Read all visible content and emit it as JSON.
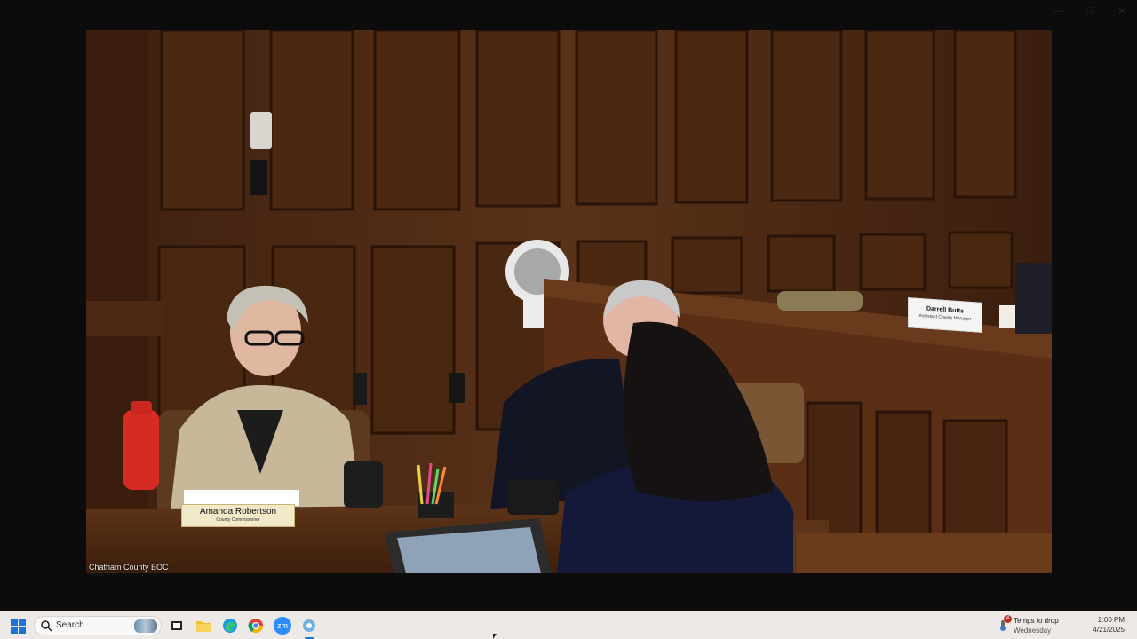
{
  "window": {
    "controls": {
      "minimize_icon": "minimize-icon",
      "maximize_icon": "maximize-icon",
      "close_icon": "close-icon"
    }
  },
  "video": {
    "label": "Chatham County BOC",
    "nameplate_left": {
      "name": "Amanda Robertson",
      "title": "County Commissioner"
    },
    "nameplate_right": {
      "name": "Darrell Butts",
      "title": "Assistant County Manager"
    }
  },
  "taskbar": {
    "search_placeholder": "Search",
    "apps": [
      {
        "name": "task-view-icon"
      },
      {
        "name": "file-explorer-icon"
      },
      {
        "name": "edge-icon"
      },
      {
        "name": "chrome-icon"
      },
      {
        "name": "zoom-icon",
        "text": "zm"
      },
      {
        "name": "video-player-icon"
      }
    ],
    "weather": {
      "line1": "Temps to drop",
      "line2": "Wednesday",
      "badge": "4"
    },
    "clock": {
      "time": "2:00 PM",
      "date": "4/21/2025"
    }
  }
}
